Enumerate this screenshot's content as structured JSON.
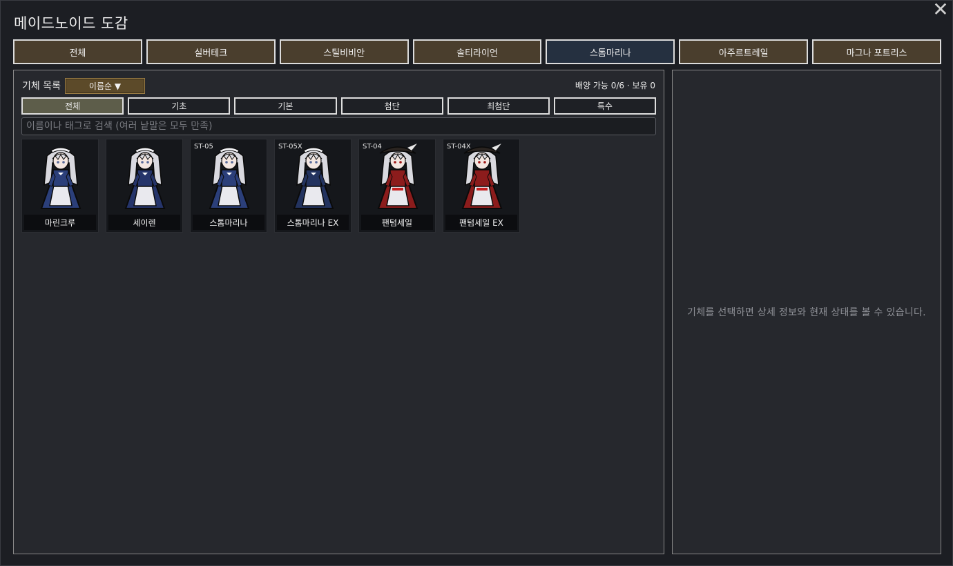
{
  "window": {
    "title": "메이드노이드 도감",
    "close_symbol": "✕"
  },
  "factions": [
    {
      "label": "전체",
      "active": false
    },
    {
      "label": "실버테크",
      "active": false
    },
    {
      "label": "스틸비비안",
      "active": false
    },
    {
      "label": "솔티라이언",
      "active": false
    },
    {
      "label": "스톰마리나",
      "active": true
    },
    {
      "label": "아주르트레일",
      "active": false
    },
    {
      "label": "마그나 포트리스",
      "active": false
    }
  ],
  "list": {
    "label": "기체 목록",
    "sort_label": "이름순 ▼",
    "deploy_info": "배양 가능 0/6 · 보유 0",
    "tiers": [
      {
        "label": "전체",
        "active": true
      },
      {
        "label": "기초",
        "active": false
      },
      {
        "label": "기본",
        "active": false
      },
      {
        "label": "첨단",
        "active": false
      },
      {
        "label": "최첨단",
        "active": false
      },
      {
        "label": "특수",
        "active": false
      }
    ],
    "search_placeholder": "이름이나 태그로 검색 (여러 낱말은 모두 만족)",
    "units": [
      {
        "code": "",
        "name": "마린크루",
        "hat": false,
        "dress": "#2b3f7a"
      },
      {
        "code": "",
        "name": "세이렌",
        "hat": false,
        "dress": "#25346a"
      },
      {
        "code": "ST-05",
        "name": "스톰마리나",
        "hat": false,
        "dress": "#2b3f7a"
      },
      {
        "code": "ST-05X",
        "name": "스톰마리나 EX",
        "hat": false,
        "dress": "#23335f"
      },
      {
        "code": "ST-04",
        "name": "팬텀세일",
        "hat": true,
        "dress": "#8c1c1c"
      },
      {
        "code": "ST-04X",
        "name": "팬텀세일 EX",
        "hat": true,
        "dress": "#8c1c1c"
      }
    ]
  },
  "detail": {
    "message": "기체를 선택하면 상세 정보와 현재 상태를 볼 수 있습니다."
  }
}
